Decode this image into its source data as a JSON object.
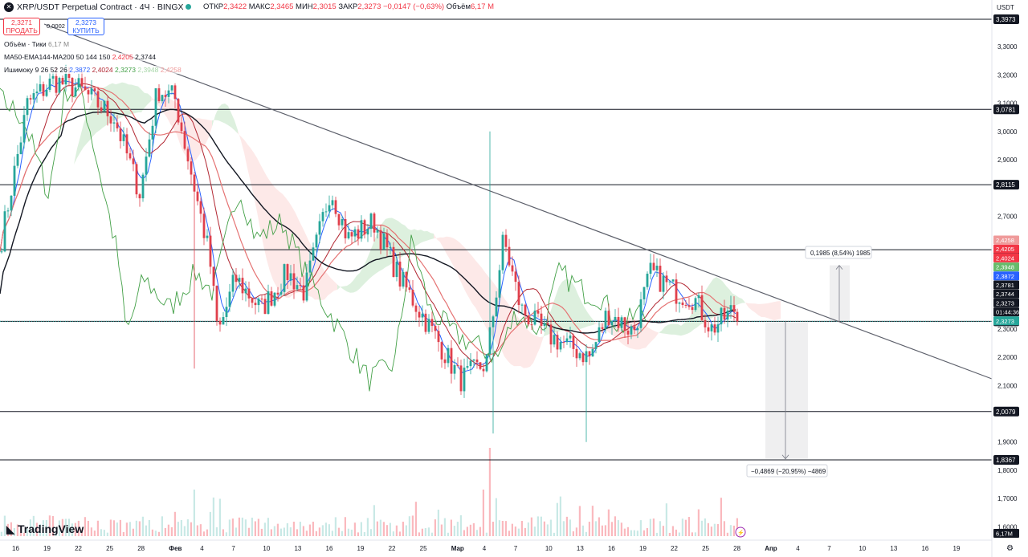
{
  "header": {
    "symbol": "XRP/USDT Perpetual Contract · 4Ч · BINGX",
    "open_label": "ОТКР",
    "open": "2,3422",
    "high_label": "МАКС",
    "high": "2,3465",
    "low_label": "МИН",
    "low": "2,3015",
    "close_label": "ЗАКР",
    "close": "2,3273",
    "change": "−0,0147 (−0,63%)",
    "volume_label": "Объём",
    "volume": "6,17 M"
  },
  "trade": {
    "sell_price": "2,3271",
    "sell_label": "ПРОДАТЬ",
    "buy_price": "2,3273",
    "buy_label": "КУПИТЬ",
    "spread": "0,0002"
  },
  "legend": {
    "volume": "Объём · Тики",
    "volume_value": "6,17 M",
    "ma_label": "MA50-EMA144-MA200 50 144 150",
    "ma_v1": "2,4205",
    "ma_v2": "2,3744",
    "ichi_label": "Ишимоку 9 26 52 26",
    "ichi_v1": "2,3872",
    "ichi_v2": "2,4024",
    "ichi_v3": "2,3273",
    "ichi_v4": "2,3948",
    "ichi_v5": "2,4258"
  },
  "currency": "USDT",
  "branding": "TradingView",
  "colors": {
    "up": "#26a69a",
    "down": "#f23645",
    "candle": "#e0404c",
    "tenkan": "#2962ff",
    "kijun": "#b22833",
    "chikou": "#43a047",
    "ma200": "#131722",
    "ema": "#e57373",
    "line": "#131722"
  },
  "chart_data": {
    "type": "candlestick",
    "timeframe": "4H",
    "ylim": [
      1.55,
      3.42
    ],
    "y_tick_labels": [
      "3,3000",
      "3,2000",
      "3,1000",
      "3,0000",
      "2,9000",
      "2,7000",
      "2,3000",
      "2,2000",
      "2,1000",
      "1,9000",
      "1,8000",
      "1,7000",
      "1,6000"
    ],
    "x_tick_labels": [
      "16",
      "19",
      "22",
      "25",
      "28",
      "Фев",
      "4",
      "7",
      "10",
      "13",
      "16",
      "19",
      "22",
      "25",
      "Мар",
      "4",
      "7",
      "10",
      "13",
      "16",
      "19",
      "22",
      "25",
      "28",
      "Апр",
      "4",
      "7",
      "10",
      "13",
      "16",
      "19"
    ],
    "close_trend": [
      [
        0,
        2.62
      ],
      [
        0.03,
        3.1
      ],
      [
        0.06,
        3.18
      ],
      [
        0.09,
        3.15
      ],
      [
        0.13,
        3.05
      ],
      [
        0.16,
        2.78
      ],
      [
        0.18,
        3.15
      ],
      [
        0.2,
        3.12
      ],
      [
        0.24,
        2.56
      ],
      [
        0.25,
        2.28
      ],
      [
        0.27,
        2.48
      ],
      [
        0.3,
        2.37
      ],
      [
        0.33,
        2.5
      ],
      [
        0.35,
        2.43
      ],
      [
        0.38,
        2.8
      ],
      [
        0.4,
        2.62
      ],
      [
        0.43,
        2.68
      ],
      [
        0.46,
        2.48
      ],
      [
        0.5,
        2.28
      ],
      [
        0.53,
        2.12
      ],
      [
        0.56,
        2.18
      ],
      [
        0.58,
        2.62
      ],
      [
        0.6,
        2.37
      ],
      [
        0.63,
        2.28
      ],
      [
        0.68,
        2.2
      ],
      [
        0.7,
        2.36
      ],
      [
        0.73,
        2.29
      ],
      [
        0.75,
        2.5
      ],
      [
        0.78,
        2.43
      ],
      [
        0.8,
        2.41
      ],
      [
        0.82,
        2.3
      ],
      [
        0.85,
        2.38
      ]
    ],
    "key_levels": [
      "3,3973",
      "3,0781",
      "2,8115",
      "2,5811",
      "2,3273",
      "2,0079",
      "1,8367"
    ],
    "price_labels": [
      {
        "value": "2,4258",
        "color": "#ef9a9a"
      },
      {
        "value": "2,4205",
        "color": "#f23645"
      },
      {
        "value": "2,4024",
        "color": "#f23645"
      },
      {
        "value": "2,3948",
        "color": "#66bb6a"
      },
      {
        "value": "2,3872",
        "color": "#2962ff"
      },
      {
        "value": "2,3781",
        "color": "#131722"
      },
      {
        "value": "2,3744",
        "color": "#131722"
      },
      {
        "value": "2,3273",
        "color": "#131722"
      },
      {
        "value": "01:44:36",
        "color": "#131722"
      },
      {
        "value": "2,3273",
        "color": "#26a69a"
      }
    ],
    "measure_up": "0,1985 (8,54%) 1985",
    "measure_down": "−0,4869 (−20,95%) −4869",
    "volume_label": "6,17M",
    "grid": false
  }
}
